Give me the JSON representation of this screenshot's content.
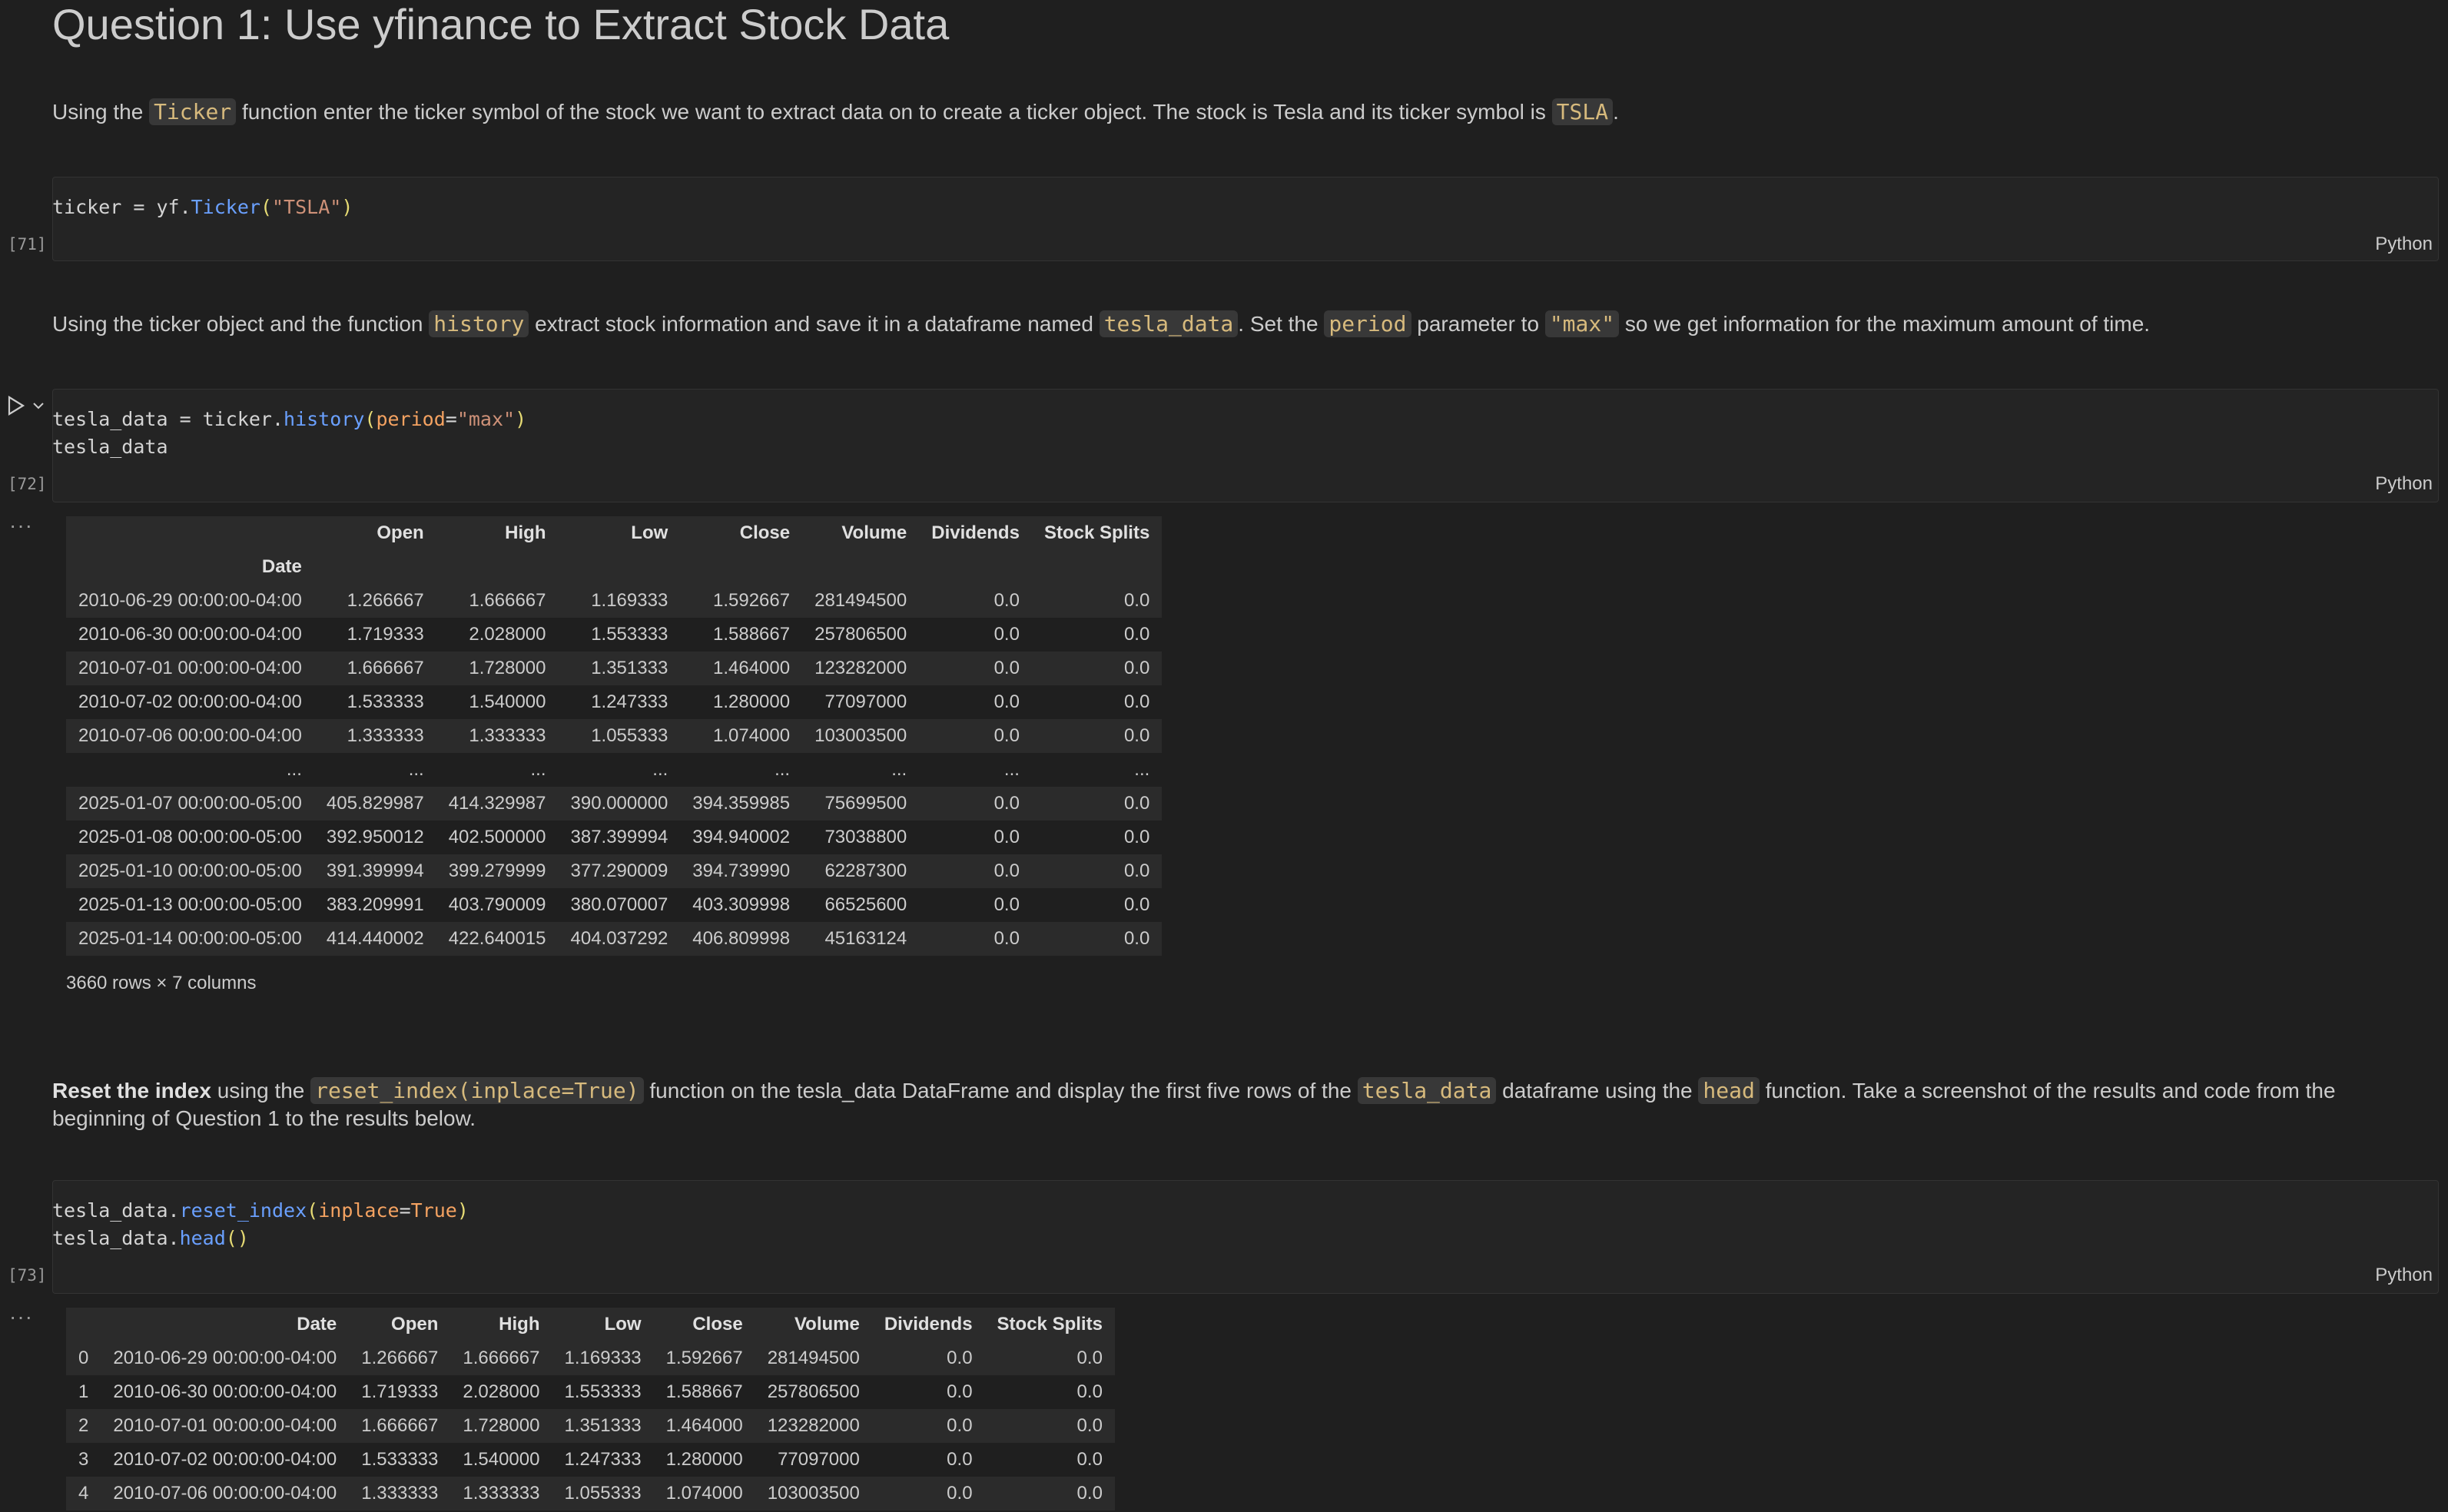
{
  "heading": "Question 1: Use yfinance to Extract Stock Data",
  "para1": {
    "t1": "Using the ",
    "c1": "Ticker",
    "t2": " function enter the ticker symbol of the stock we want to extract data on to create a ticker object. The stock is Tesla and its ticker symbol is ",
    "c2": "TSLA",
    "t3": "."
  },
  "cell71": {
    "exec": "[71]",
    "lang": "Python",
    "l1a": "ticker = yf.",
    "l1b": "Ticker",
    "l1c": "(",
    "l1d": "\"TSLA\"",
    "l1e": ")"
  },
  "para2": {
    "t1": "Using the ticker object and the function ",
    "c1": "history",
    "t2": " extract stock information and save it in a dataframe named ",
    "c2": "tesla_data",
    "t3": ". Set the ",
    "c3": "period",
    "t4": " parameter to ",
    "c4": "\"max\"",
    "t5": " so we get information for the maximum amount of time."
  },
  "cell72": {
    "exec": "[72]",
    "lang": "Python",
    "l1a": "tesla_data = ticker.",
    "l1b": "history",
    "l1c": "(",
    "l1d": "period",
    "l1e": "=",
    "l1f": "\"max\"",
    "l1g": ")",
    "l2": "tesla_data",
    "output_dots": "···",
    "shape": "3660 rows × 7 columns",
    "table": {
      "columns": [
        "Open",
        "High",
        "Low",
        "Close",
        "Volume",
        "Dividends",
        "Stock Splits"
      ],
      "index_name": "Date",
      "rows": [
        [
          "2010-06-29 00:00:00-04:00",
          "1.266667",
          "1.666667",
          "1.169333",
          "1.592667",
          "281494500",
          "0.0",
          "0.0"
        ],
        [
          "2010-06-30 00:00:00-04:00",
          "1.719333",
          "2.028000",
          "1.553333",
          "1.588667",
          "257806500",
          "0.0",
          "0.0"
        ],
        [
          "2010-07-01 00:00:00-04:00",
          "1.666667",
          "1.728000",
          "1.351333",
          "1.464000",
          "123282000",
          "0.0",
          "0.0"
        ],
        [
          "2010-07-02 00:00:00-04:00",
          "1.533333",
          "1.540000",
          "1.247333",
          "1.280000",
          "77097000",
          "0.0",
          "0.0"
        ],
        [
          "2010-07-06 00:00:00-04:00",
          "1.333333",
          "1.333333",
          "1.055333",
          "1.074000",
          "103003500",
          "0.0",
          "0.0"
        ],
        [
          "...",
          "...",
          "...",
          "...",
          "...",
          "...",
          "...",
          "..."
        ],
        [
          "2025-01-07 00:00:00-05:00",
          "405.829987",
          "414.329987",
          "390.000000",
          "394.359985",
          "75699500",
          "0.0",
          "0.0"
        ],
        [
          "2025-01-08 00:00:00-05:00",
          "392.950012",
          "402.500000",
          "387.399994",
          "394.940002",
          "73038800",
          "0.0",
          "0.0"
        ],
        [
          "2025-01-10 00:00:00-05:00",
          "391.399994",
          "399.279999",
          "377.290009",
          "394.739990",
          "62287300",
          "0.0",
          "0.0"
        ],
        [
          "2025-01-13 00:00:00-05:00",
          "383.209991",
          "403.790009",
          "380.070007",
          "403.309998",
          "66525600",
          "0.0",
          "0.0"
        ],
        [
          "2025-01-14 00:00:00-05:00",
          "414.440002",
          "422.640015",
          "404.037292",
          "406.809998",
          "45163124",
          "0.0",
          "0.0"
        ]
      ]
    }
  },
  "para3": {
    "b1": "Reset the index",
    "t1": " using the ",
    "c1": "reset_index(inplace=True)",
    "t2": " function on the tesla_data DataFrame and display the first five rows of the ",
    "c2": "tesla_data",
    "t3": " dataframe using the ",
    "c3": "head",
    "t4": " function. Take a screenshot of the results and code from the beginning of Question 1 to the results below."
  },
  "cell73": {
    "exec": "[73]",
    "lang": "Python",
    "l1a": "tesla_data.",
    "l1b": "reset_index",
    "l1c": "(",
    "l1d": "inplace",
    "l1e": "=",
    "l1f": "True",
    "l1g": ")",
    "l2a": "tesla_data.",
    "l2b": "head",
    "l2c": "()",
    "output_dots": "···",
    "table": {
      "columns": [
        "",
        "Date",
        "Open",
        "High",
        "Low",
        "Close",
        "Volume",
        "Dividends",
        "Stock Splits"
      ],
      "rows": [
        [
          "0",
          "2010-06-29 00:00:00-04:00",
          "1.266667",
          "1.666667",
          "1.169333",
          "1.592667",
          "281494500",
          "0.0",
          "0.0"
        ],
        [
          "1",
          "2010-06-30 00:00:00-04:00",
          "1.719333",
          "2.028000",
          "1.553333",
          "1.588667",
          "257806500",
          "0.0",
          "0.0"
        ],
        [
          "2",
          "2010-07-01 00:00:00-04:00",
          "1.666667",
          "1.728000",
          "1.351333",
          "1.464000",
          "123282000",
          "0.0",
          "0.0"
        ],
        [
          "3",
          "2010-07-02 00:00:00-04:00",
          "1.533333",
          "1.540000",
          "1.247333",
          "1.280000",
          "77097000",
          "0.0",
          "0.0"
        ],
        [
          "4",
          "2010-07-06 00:00:00-04:00",
          "1.333333",
          "1.333333",
          "1.055333",
          "1.074000",
          "103003500",
          "0.0",
          "0.0"
        ]
      ]
    }
  },
  "icons": {
    "run": "play-icon",
    "collapse": "chevron-down-icon"
  }
}
